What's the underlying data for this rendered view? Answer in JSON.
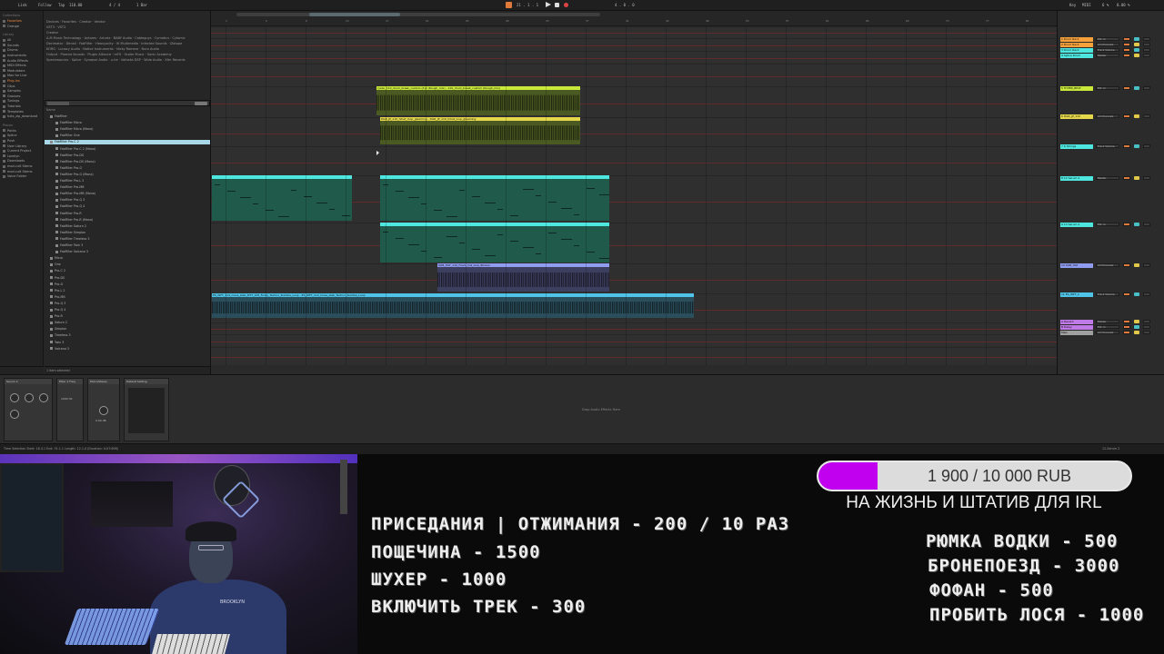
{
  "topbar": {
    "left_menu": [
      "Link",
      "Follow",
      "Tap",
      "110.00",
      "4 / 4",
      "1 Bar",
      "Key",
      "MIDI"
    ],
    "position": "21 . 1 . 1",
    "loop": "4 . 0 . 0",
    "right": [
      "Key",
      "MIDI",
      "6 %",
      "0.00 %"
    ]
  },
  "browser": {
    "places_sections": {
      "collections_header": "Collections",
      "library_header": "Library",
      "places_header": "Places"
    },
    "collections": [
      "Favorites",
      "Orange"
    ],
    "library": [
      "All",
      "Sounds",
      "Drums",
      "Instruments",
      "Audio Effects",
      "MIDI Effects",
      "Modulators",
      "Max for Live",
      "Plug-Ins",
      "Clips",
      "Samples",
      "Grooves",
      "Tunings",
      "Tutorials",
      "Templates",
      "hxts_zip_download"
    ],
    "places": [
      "Packs",
      "Splice",
      "Push",
      "User Library",
      "Current Project",
      "Lovelyn",
      "Downloads",
      "mod.cult Stems",
      "mod.cult Stems",
      "Voice Folder"
    ],
    "tags_lines": [
      "Devices  ·  Favorites  ·  Creator  ·  Vendor",
      "VST3  ·  VST2",
      "Creator",
      "A.M Music Technology  ·  Antares  ·  Arturia  ·  BABY Audio  ·  Cableguys  ·  Cymatics  ·  Cytomic",
      "Decimator  ·  Denali  ·  FabFilter  ·  Heavyocity  ·  IK Multimedia  ·  Infected Sounds  ·  iZotope",
      "KORG  ·  Lunacy Audio  ·  Native Instruments  ·  Nicky Romero  ·  Nuro Audio",
      "Output  ·  Plasma Sounds  ·  Plugin Alliance  ·  reFX  ·  Scaler Music  ·  Sonic Academy",
      "Spectrasonics  ·  Splice  ·  Synapse Audio  ·  u-he  ·  Valhalla DSP  ·  Wide Audio  ·  Xfer Records"
    ],
    "search_label": "Search",
    "filter_label": "FabFilter",
    "column_header": "Name",
    "files": [
      "FabFilter",
      "FabFilter Micro",
      "FabFilter Micro (Mono)",
      "FabFilter One",
      "FabFilter Pro-C 2",
      "FabFilter Pro-C 2 (Mono)",
      "FabFilter Pro-DS",
      "FabFilter Pro-DS (Mono)",
      "FabFilter Pro-G",
      "FabFilter Pro-G (Mono)",
      "FabFilter Pro-L 2",
      "FabFilter Pro-MB",
      "FabFilter Pro-MB (Mono)",
      "FabFilter Pro-Q 3",
      "FabFilter Pro-Q 4",
      "FabFilter Pro-R",
      "FabFilter Pro-R (Mono)",
      "FabFilter Saturn 2",
      "FabFilter Simplon",
      "FabFilter Timeless 3",
      "FabFilter Twin 3",
      "FabFilter Volcano 3",
      "Micro",
      "One",
      "Pro-C 2",
      "Pro-DS",
      "Pro-G",
      "Pro-L 2",
      "Pro-MB",
      "Pro-Q 3",
      "Pro-Q 4",
      "Pro-R",
      "Saturn 2",
      "Simplon",
      "Timeless 3",
      "Twin 3",
      "Volcano 3"
    ],
    "selected_index": 4,
    "status": "1 item selected"
  },
  "arrangement": {
    "ruler_ticks": [
      "1",
      "5",
      "9",
      "13",
      "17",
      "21",
      "25",
      "29",
      "33",
      "37",
      "41",
      "45",
      "49",
      "53",
      "57",
      "61",
      "65",
      "69",
      "73",
      "77",
      "81",
      "85",
      "89",
      "93",
      "97",
      "101",
      "105",
      "109"
    ],
    "bottom_ticks": [
      "0:00",
      "0:10",
      "0:20",
      "0:30",
      "0:40",
      "0:50",
      "1:00",
      "1:10",
      "1:20",
      "1:30",
      "1:40",
      "1:50",
      "2:00",
      "2:10",
      "2:20",
      "2:30",
      "2:40",
      "2:50",
      "3:00",
      "3:10",
      "3:20",
      "3:30"
    ],
    "clips": [
      {
        "label": "ryzen_110_drum_break_custom (4)2 (Rough_mix) - 110_drum_break_custom (Rough_mix)",
        "color": "#c9e93a"
      },
      {
        "label": "DGR_JP_110_hihat_loop_gleaming - DGR_JP_110_hihat_loop_gleaming",
        "color": "#e4d84a"
      },
      {
        "label": "",
        "color": "#4de7e0"
      },
      {
        "label": "",
        "color": "#4de7e0"
      },
      {
        "label": "",
        "color": "#4de7e0"
      },
      {
        "label": "SOB_HAT_110_Foam_hat_loop_Bmaxx",
        "color": "#8f9cf0"
      },
      {
        "label": "ES_WFT_114_moss_stab_MTT_105_Fuzzy_Techno_Rumble_Loop - ES_WFT_114_moss_stab_Techno_Rumble_Loop",
        "color": "#4fc4e8"
      }
    ]
  },
  "mixer": {
    "tracks": [
      {
        "name": "1 Drum Rack",
        "color": "#f7a13a"
      },
      {
        "name": "2 Drum Rack",
        "color": "#f7a13a"
      },
      {
        "name": "3 Drum Rack",
        "color": "#4de7e0"
      },
      {
        "name": "4 Splice Drum",
        "color": "#4de7e0"
      },
      {
        "name": "5 HYPER_BEAT",
        "color": "#c9e93a"
      },
      {
        "name": "6 DGR_JP_110",
        "color": "#e4d84a"
      },
      {
        "name": "7 6 Strings",
        "color": "#4de7e0"
      },
      {
        "name": "8 12 Serum 2",
        "color": "#4de7e0"
      },
      {
        "name": "9 13 Serum 2",
        "color": "#4de7e0"
      },
      {
        "name": "10 SOB_HAT",
        "color": "#8f9cf0"
      },
      {
        "name": "11 ES_WFT_1",
        "color": "#4fc4e8"
      },
      {
        "name": "A Reverb",
        "color": "#c07ae8"
      },
      {
        "name": "B Delay",
        "color": "#c07ae8"
      },
      {
        "name": "Main",
        "color": "#a0a0a0"
      }
    ],
    "routing_labels": [
      "Ext. In",
      "All Channels",
      "Track Volume",
      "Master",
      "In",
      "Auto",
      "Off"
    ]
  },
  "devices": {
    "chain": [
      "Serum 2",
      "Filter 1 Freq",
      "Global Mod",
      "Mono/Stereo",
      "Default Setting"
    ],
    "empty_hint": "Drop Audio Effects Here",
    "freq_value": "1000 Hz",
    "gain_value": "0.00 dB"
  },
  "statusbar": {
    "left": "Time Selection   Start: 18.4.1   End: 31.1.1   Length: 12.1.0 (Duration: 0:07:698)",
    "right": "12-Serum 2"
  },
  "stream": {
    "goal": {
      "current": 1900,
      "target": 10000,
      "currency": "RUB",
      "text": "1 900 / 10 000 RUB",
      "subtitle": "НА ЖИЗНЬ И ШТАТИВ ДЛЯ IRL",
      "fill_color": "#c000ee"
    },
    "prices_left": [
      "ПРИСЕДАНИЯ | ОТЖИМАНИЯ - 200 / 10 РАЗ",
      "ПОЩЕЧИНА - 1500",
      "ШУХЕР - 1000",
      "ВКЛЮЧИТЬ ТРЕК - 300"
    ],
    "prices_right": [
      "РЮМКА ВОДКИ - 500",
      "БРОНЕПОЕЗД - 3000",
      "ФОФАН - 500",
      "ПРОБИТЬ ЛОСЯ - 1000"
    ],
    "shirt_text": "BROOKLYN"
  }
}
